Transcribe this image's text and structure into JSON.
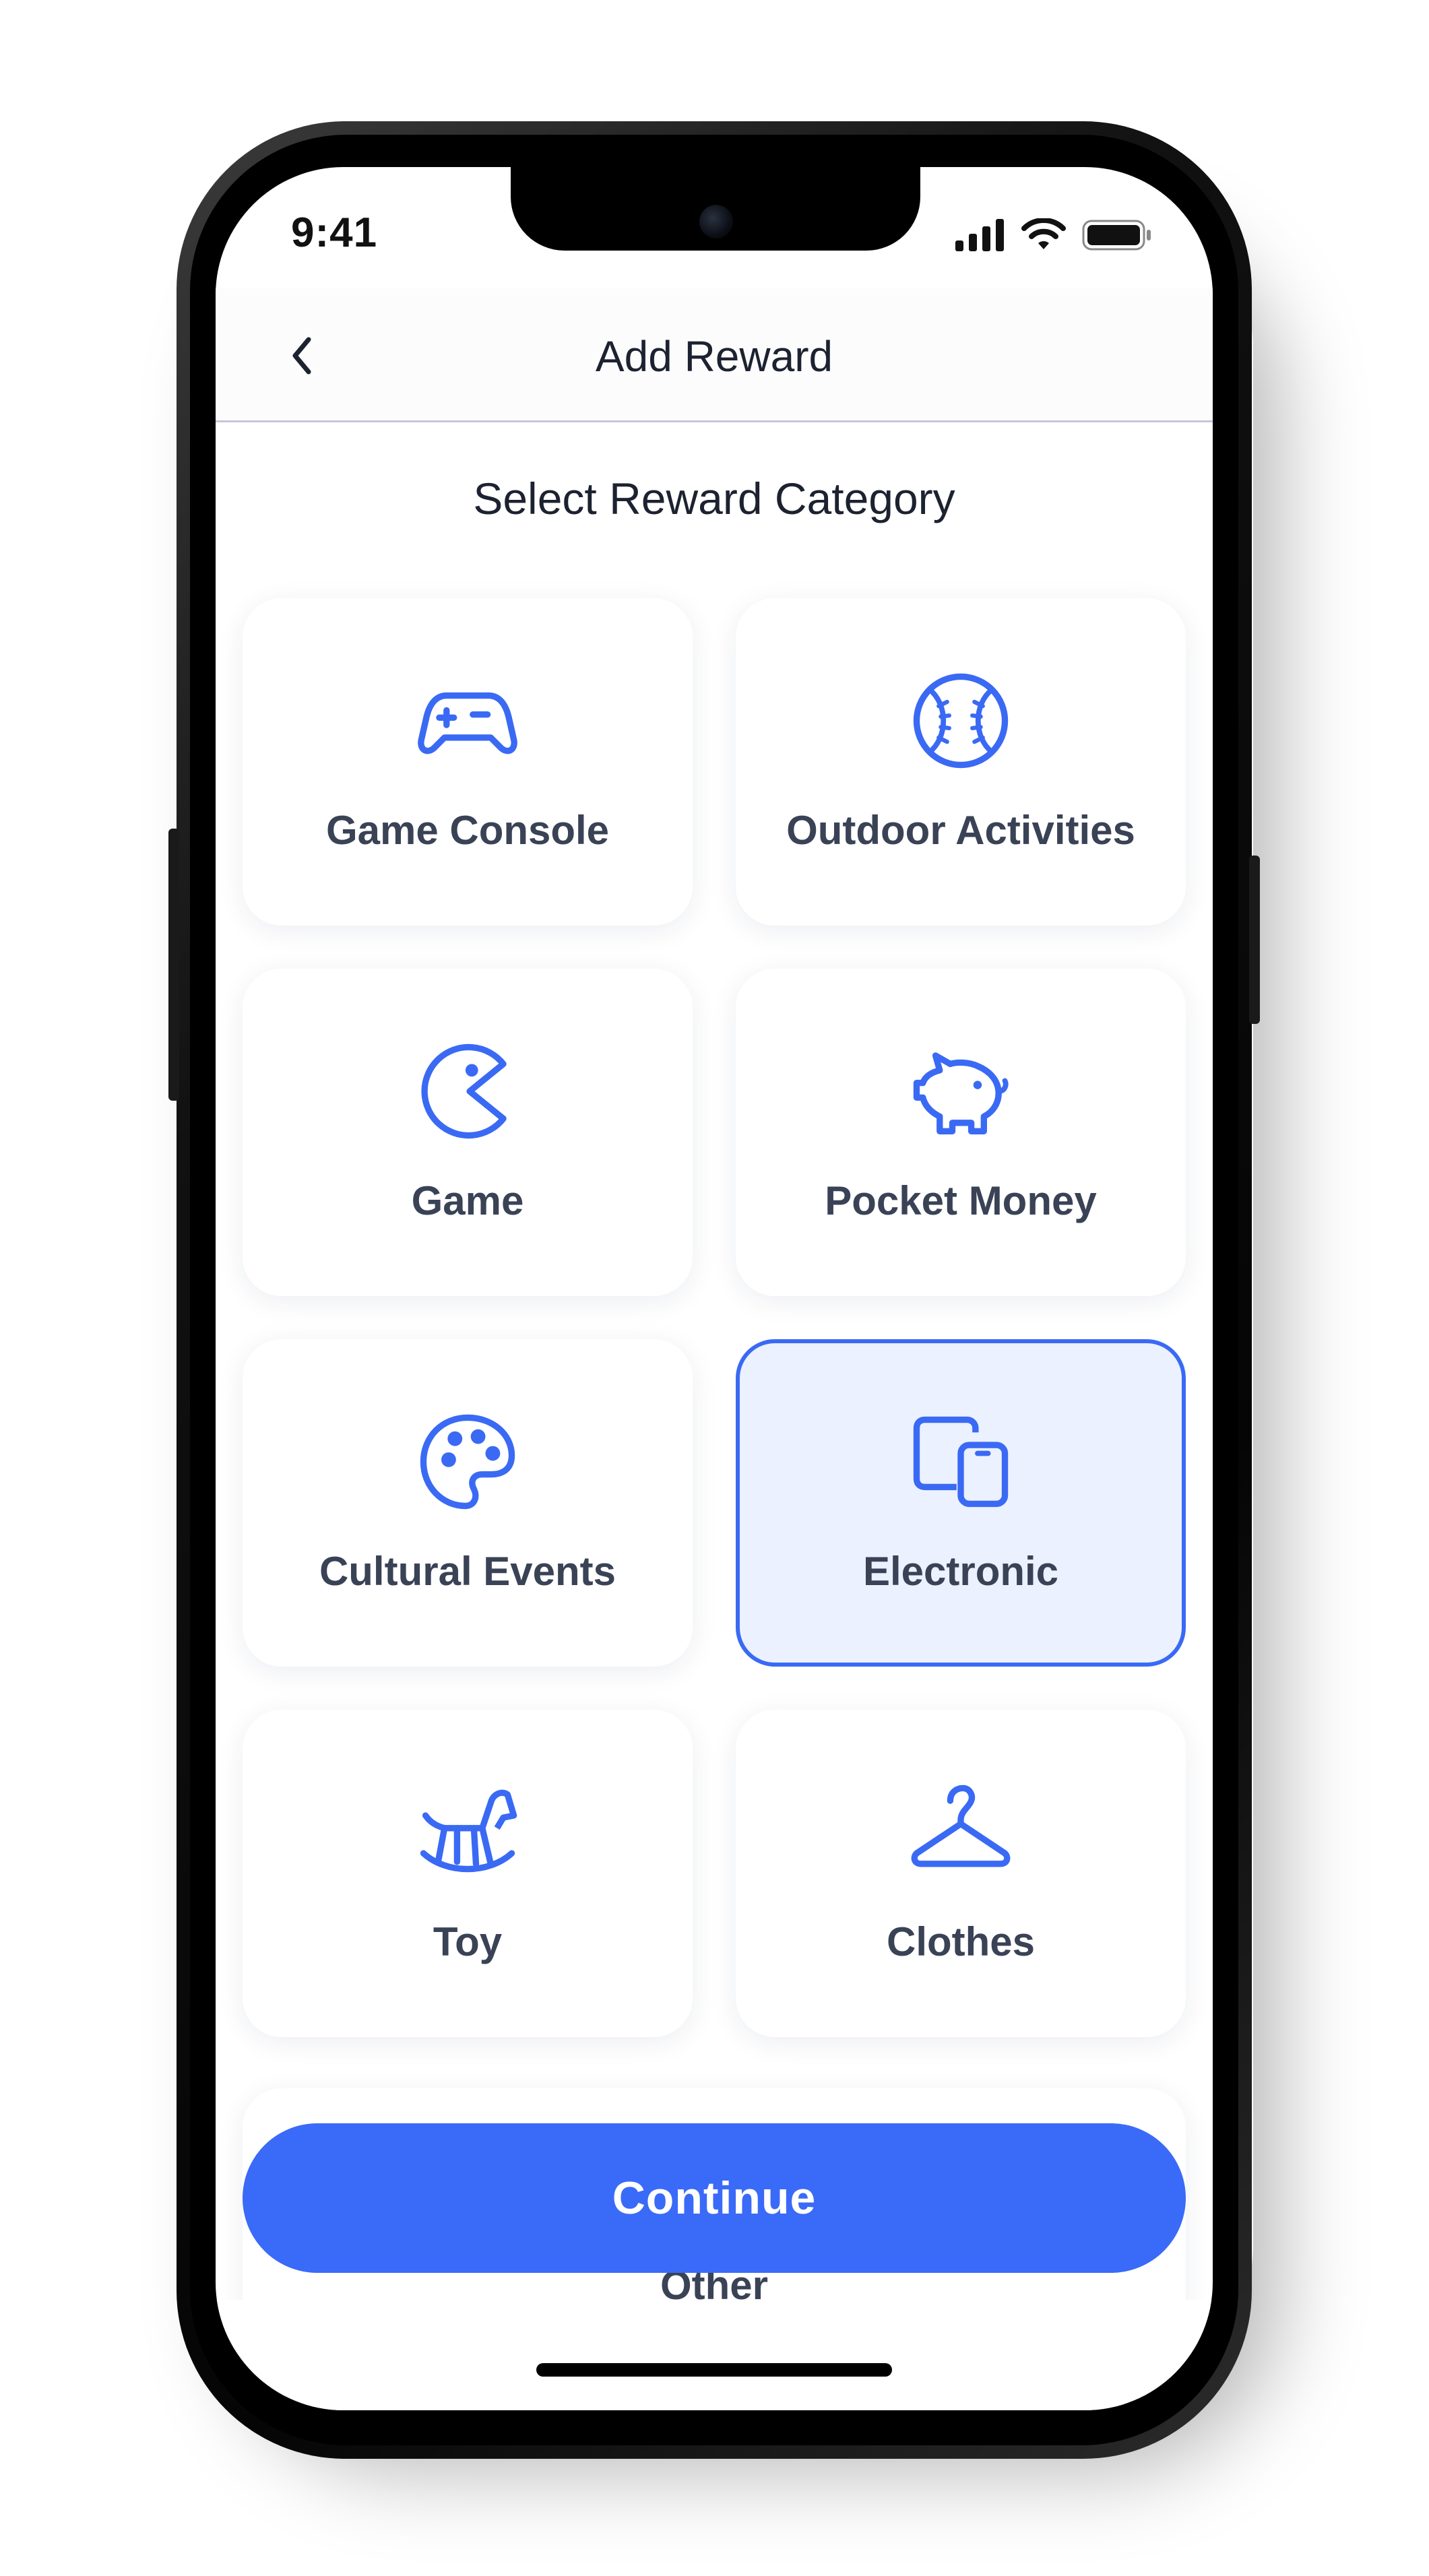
{
  "status_bar": {
    "time": "9:41"
  },
  "nav": {
    "title": "Add Reward"
  },
  "section_title": "Select Reward Category",
  "categories": [
    {
      "label": "Game Console",
      "icon": "gamepad-icon",
      "selected": false
    },
    {
      "label": "Outdoor Activities",
      "icon": "baseball-icon",
      "selected": false
    },
    {
      "label": "Game",
      "icon": "pacman-icon",
      "selected": false
    },
    {
      "label": "Pocket Money",
      "icon": "piggy-bank-icon",
      "selected": false
    },
    {
      "label": "Cultural Events",
      "icon": "palette-icon",
      "selected": false
    },
    {
      "label": "Electronic",
      "icon": "devices-icon",
      "selected": true
    },
    {
      "label": "Toy",
      "icon": "rocking-horse-icon",
      "selected": false
    },
    {
      "label": "Clothes",
      "icon": "hanger-icon",
      "selected": false
    },
    {
      "label": "Other",
      "icon": "",
      "selected": false
    }
  ],
  "continue_label": "Continue",
  "colors": {
    "accent": "#3a6af8",
    "selected_bg": "#ebf1fe",
    "label": "#3a4256",
    "title": "#1c2230"
  }
}
